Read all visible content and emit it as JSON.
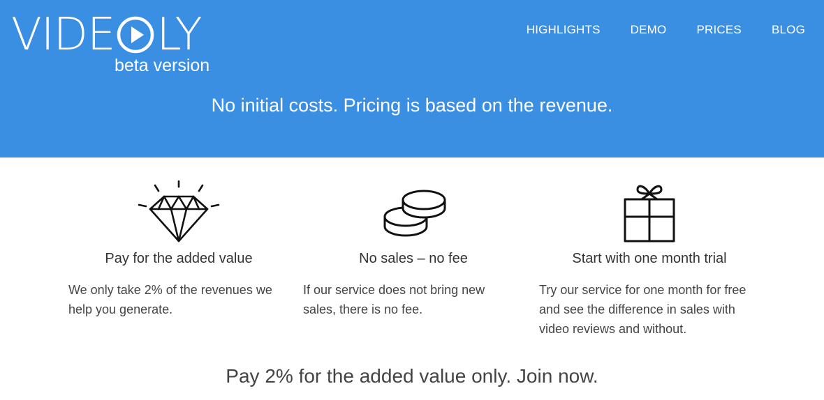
{
  "brand": {
    "name_left": "VIDE",
    "name_right": "LY",
    "subtitle": "beta version",
    "logo_icon": "play-circle-icon"
  },
  "nav": {
    "items": [
      {
        "label": "HIGHLIGHTS"
      },
      {
        "label": "DEMO"
      },
      {
        "label": "PRICES"
      },
      {
        "label": "BLOG"
      }
    ]
  },
  "hero": {
    "tagline": "No initial costs. Pricing is based on the revenue.",
    "background_color": "#3b8fe3"
  },
  "features": [
    {
      "icon": "diamond-icon",
      "title": "Pay for the added value",
      "text": "We only take 2% of the revenues we help you generate."
    },
    {
      "icon": "coins-icon",
      "title": "No sales – no fee",
      "text": "If our service does not bring new sales, there is no fee."
    },
    {
      "icon": "gift-icon",
      "title": "Start with one month trial",
      "text": "Try our service for one month for free and see the difference in sales with video reviews and without."
    }
  ],
  "cta": {
    "text": "Pay 2% for the added value only. Join now."
  }
}
